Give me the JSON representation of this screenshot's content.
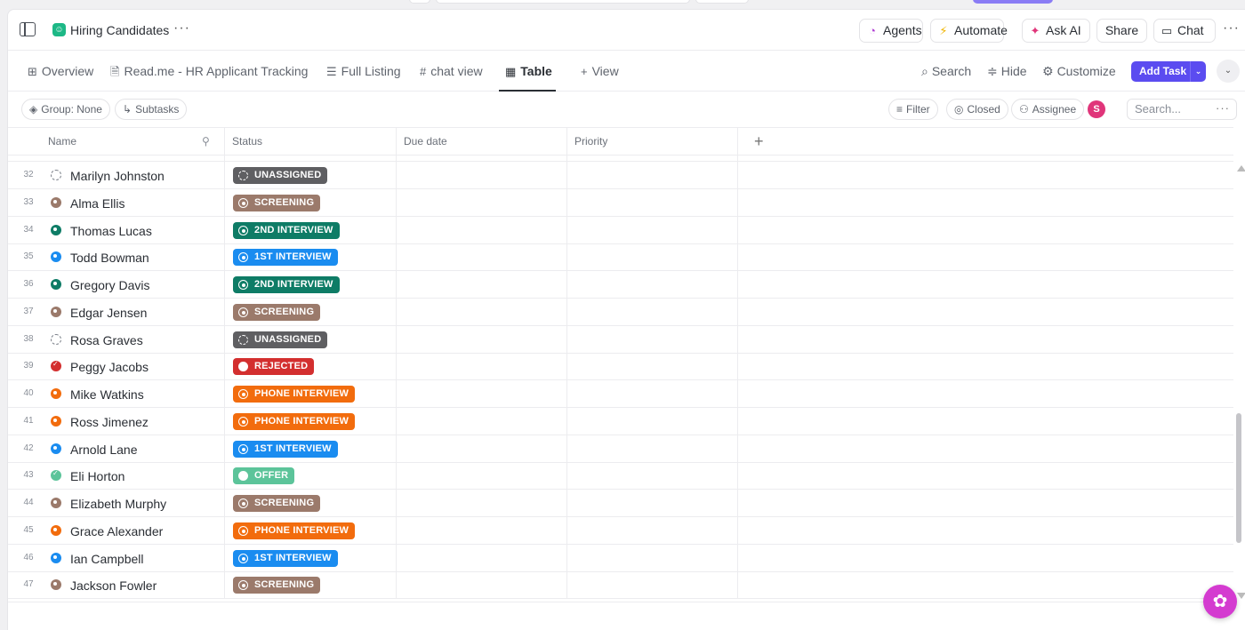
{
  "header": {
    "title": "Hiring Candidates",
    "more": "···",
    "agents_label": "Agents",
    "automate_label": "Automate",
    "askai_label": "Ask AI",
    "share_label": "Share",
    "chat_label": "Chat",
    "more_right": "···"
  },
  "views": {
    "tabs": [
      {
        "label": "Overview",
        "icon": "grid-icon"
      },
      {
        "label": "Read.me - HR Applicant Tracking",
        "icon": "doc-icon"
      },
      {
        "label": "Full Listing",
        "icon": "list-icon"
      },
      {
        "label": "chat view",
        "icon": "hash-icon"
      },
      {
        "label": "Table",
        "icon": "table-icon"
      }
    ],
    "add_view_label": "View",
    "search_label": "Search",
    "hide_label": "Hide",
    "customize_label": "Customize",
    "add_task_label": "Add Task"
  },
  "filters": {
    "group_label": "Group: None",
    "subtasks_label": "Subtasks",
    "filter_label": "Filter",
    "closed_label": "Closed",
    "assignee_label": "Assignee",
    "avatar_initial": "S",
    "search_placeholder": "Search...",
    "search_more": "···"
  },
  "columns": {
    "name": "Name",
    "status": "Status",
    "due": "Due date",
    "priority": "Priority",
    "add": "+"
  },
  "colors": {
    "UNASSIGNED": "#5f5f62",
    "SCREENING": "#9b7a6b",
    "2ND INTERVIEW": "#0e7c66",
    "1ST INTERVIEW": "#1a8cf0",
    "REJECTED": "#d32f2f",
    "PHONE INTERVIEW": "#f26c0d",
    "OFFER": "#5cc49a"
  },
  "rows": [
    {
      "num": "32",
      "name": "Marilyn Johnston",
      "status": "UNASSIGNED"
    },
    {
      "num": "33",
      "name": "Alma Ellis",
      "status": "SCREENING"
    },
    {
      "num": "34",
      "name": "Thomas Lucas",
      "status": "2ND INTERVIEW"
    },
    {
      "num": "35",
      "name": "Todd Bowman",
      "status": "1ST INTERVIEW"
    },
    {
      "num": "36",
      "name": "Gregory Davis",
      "status": "2ND INTERVIEW"
    },
    {
      "num": "37",
      "name": "Edgar Jensen",
      "status": "SCREENING"
    },
    {
      "num": "38",
      "name": "Rosa Graves",
      "status": "UNASSIGNED"
    },
    {
      "num": "39",
      "name": "Peggy Jacobs",
      "status": "REJECTED"
    },
    {
      "num": "40",
      "name": "Mike Watkins",
      "status": "PHONE INTERVIEW"
    },
    {
      "num": "41",
      "name": "Ross Jimenez",
      "status": "PHONE INTERVIEW"
    },
    {
      "num": "42",
      "name": "Arnold Lane",
      "status": "1ST INTERVIEW"
    },
    {
      "num": "43",
      "name": "Eli Horton",
      "status": "OFFER"
    },
    {
      "num": "44",
      "name": "Elizabeth Murphy",
      "status": "SCREENING"
    },
    {
      "num": "45",
      "name": "Grace Alexander",
      "status": "PHONE INTERVIEW"
    },
    {
      "num": "46",
      "name": "Ian Campbell",
      "status": "1ST INTERVIEW"
    },
    {
      "num": "47",
      "name": "Jackson Fowler",
      "status": "SCREENING"
    }
  ]
}
